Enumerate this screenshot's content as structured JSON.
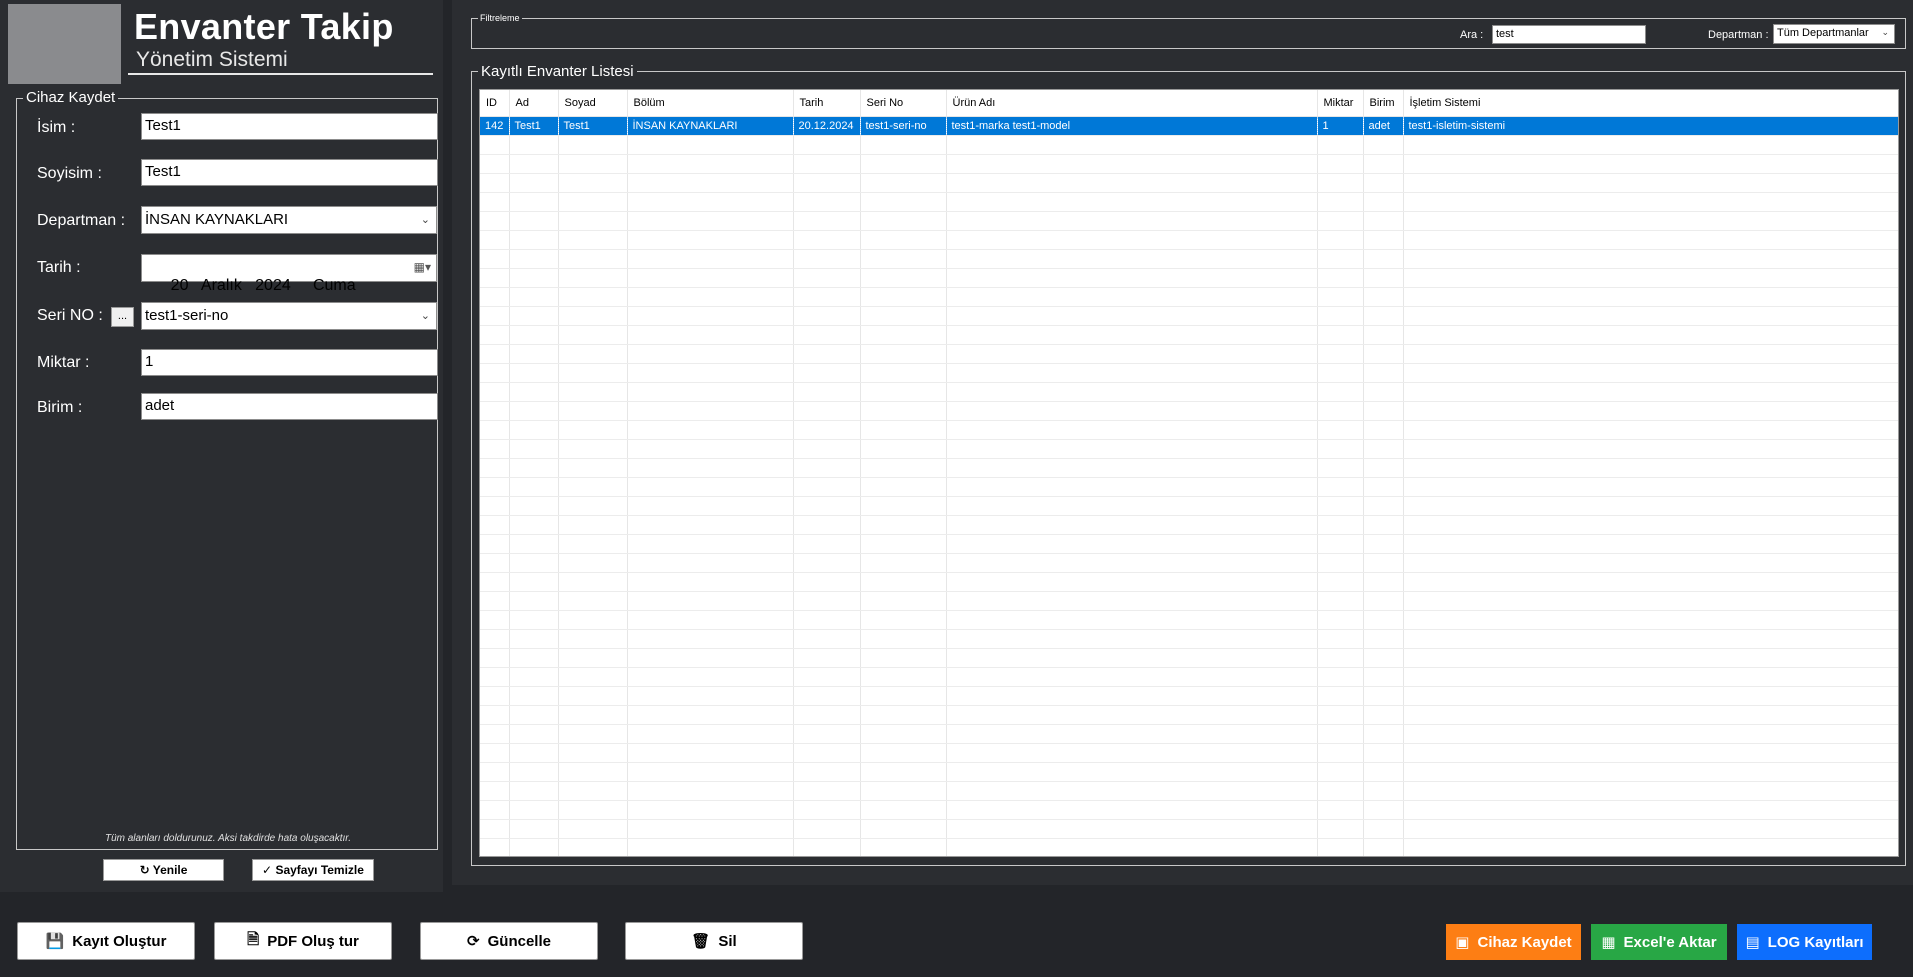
{
  "header": {
    "title": "Envanter Takip",
    "subtitle": "Yönetim Sistemi"
  },
  "form": {
    "legend": "Cihaz Kaydet",
    "labels": {
      "name": "İsim :",
      "surname": "Soyisim :",
      "department": "Departman :",
      "date": "Tarih :",
      "serial": "Seri NO :",
      "quantity": "Miktar :",
      "unit": "Birim :"
    },
    "values": {
      "name": "Test1",
      "surname": "Test1",
      "department": "İNSAN KAYNAKLARI",
      "date": "20   Aralık   2024     Cuma",
      "serial": "test1-seri-no",
      "quantity": "1",
      "unit": "adet"
    },
    "serial_button": "...",
    "hint": "Tüm alanları doldurunuz. Aksi takdirde hata oluşacaktır."
  },
  "actions": {
    "refresh": "Yenile",
    "clear": "Sayfayı Temizle"
  },
  "filter": {
    "legend": "Filtreleme",
    "search_label": "Ara :",
    "search_value": "test",
    "department_label": "Departman :",
    "department_value": "Tüm Departmanlar"
  },
  "list": {
    "legend": "Kayıtlı Envanter Listesi",
    "columns": [
      "ID",
      "Ad",
      "Soyad",
      "Bölüm",
      "Tarih",
      "Seri No",
      "Ürün Adı",
      "Miktar",
      "Birim",
      "İşletim Sistemi"
    ],
    "rows": [
      [
        "142",
        "Test1",
        "Test1",
        "İNSAN KAYNAKLARI",
        "20.12.2024",
        "test1-seri-no",
        "test1-marka test1-model",
        "1",
        "adet",
        "test1-isletim-sistemi"
      ]
    ]
  },
  "bottom": {
    "create": "Kayıt Oluştur",
    "pdf": "PDF Oluş tur",
    "update": "Güncelle",
    "delete": "Sil",
    "save_device": "Cihaz Kaydet",
    "excel": "Excel'e Aktar",
    "log": "LOG Kayıtları"
  },
  "colors": {
    "save_device": "#fd7e14",
    "excel": "#28a745",
    "log": "#0d6efd",
    "selection": "#0078d7"
  },
  "icons": {
    "create": "save-icon",
    "pdf": "pdf-icon",
    "update": "refresh-icon",
    "delete": "trash-icon",
    "save_device": "device-icon",
    "excel": "excel-icon",
    "log": "log-icon"
  }
}
